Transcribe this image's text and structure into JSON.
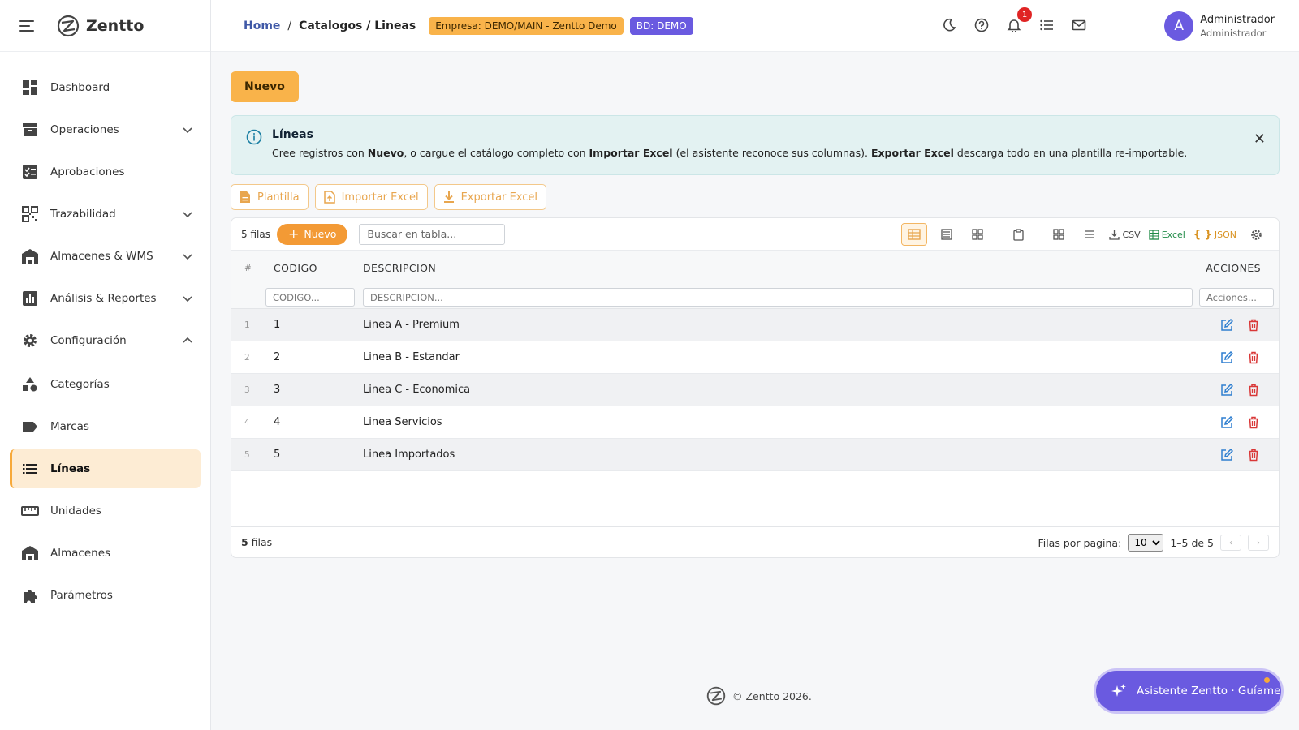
{
  "brand": {
    "name": "Zentto"
  },
  "sidebar": {
    "items": [
      {
        "label": "Dashboard"
      },
      {
        "label": "Operaciones"
      },
      {
        "label": "Aprobaciones"
      },
      {
        "label": "Trazabilidad"
      },
      {
        "label": "Almacenes & WMS"
      },
      {
        "label": "Análisis & Reportes"
      },
      {
        "label": "Configuración"
      },
      {
        "label": "Categorías"
      },
      {
        "label": "Marcas"
      },
      {
        "label": "Líneas"
      },
      {
        "label": "Unidades"
      },
      {
        "label": "Almacenes"
      },
      {
        "label": "Parámetros"
      }
    ]
  },
  "header": {
    "breadcrumb_home": "Home",
    "breadcrumb_sep": "/",
    "breadcrumb_current": "Catalogos / Lineas",
    "empresa_badge": "Empresa: DEMO/MAIN - Zentto Demo",
    "bd_badge": "BD: DEMO",
    "notif_count": "1",
    "user_initial": "A",
    "user_name": "Administrador",
    "user_role": "Administrador"
  },
  "main": {
    "nuevo_label": "Nuevo",
    "info": {
      "title": "Líneas",
      "t1": "Cree registros con ",
      "b1": "Nuevo",
      "t2": ", o cargue el catálogo completo con ",
      "b2": "Importar Excel",
      "t3": " (el asistente reconoce sus columnas). ",
      "b3": "Exportar Excel",
      "t4": " descarga todo en una plantilla re-importable.",
      "close": "✕"
    },
    "buttons": {
      "plantilla": "Plantilla",
      "importar": "Importar Excel",
      "exportar": "Exportar Excel"
    }
  },
  "grid": {
    "row_count_label": "5 filas",
    "nuevo_label": "Nuevo",
    "search_placeholder": "Buscar en tabla...",
    "toolbar": {
      "csv": "CSV",
      "excel": "Excel",
      "json": "JSON"
    },
    "columns": {
      "num": "#",
      "codigo": "CODIGO",
      "descripcion": "DESCRIPCION",
      "acciones": "ACCIONES"
    },
    "filters": {
      "codigo": "CODIGO...",
      "descripcion": "DESCRIPCION...",
      "acciones": "Acciones..."
    },
    "rows": [
      {
        "n": "1",
        "codigo": "1",
        "descripcion": "Linea A - Premium"
      },
      {
        "n": "2",
        "codigo": "2",
        "descripcion": "Linea B - Estandar"
      },
      {
        "n": "3",
        "codigo": "3",
        "descripcion": "Linea C - Economica"
      },
      {
        "n": "4",
        "codigo": "4",
        "descripcion": "Linea Servicios"
      },
      {
        "n": "5",
        "codigo": "5",
        "descripcion": "Linea Importados"
      }
    ],
    "footer": {
      "count_num": "5",
      "count_label": " filas",
      "per_page_label": "Filas por pagina:",
      "per_page_value": "10",
      "range": "1–5 de 5",
      "prev": "‹",
      "next": "›"
    }
  },
  "page_footer": "© Zentto 2026.",
  "assistant": {
    "label": "Asistente Zentto · Guíame"
  },
  "colors": {
    "accent": "#f9b34a",
    "brand": "#6a5ae0",
    "edit": "#2f7fd0",
    "delete": "#d93737"
  }
}
